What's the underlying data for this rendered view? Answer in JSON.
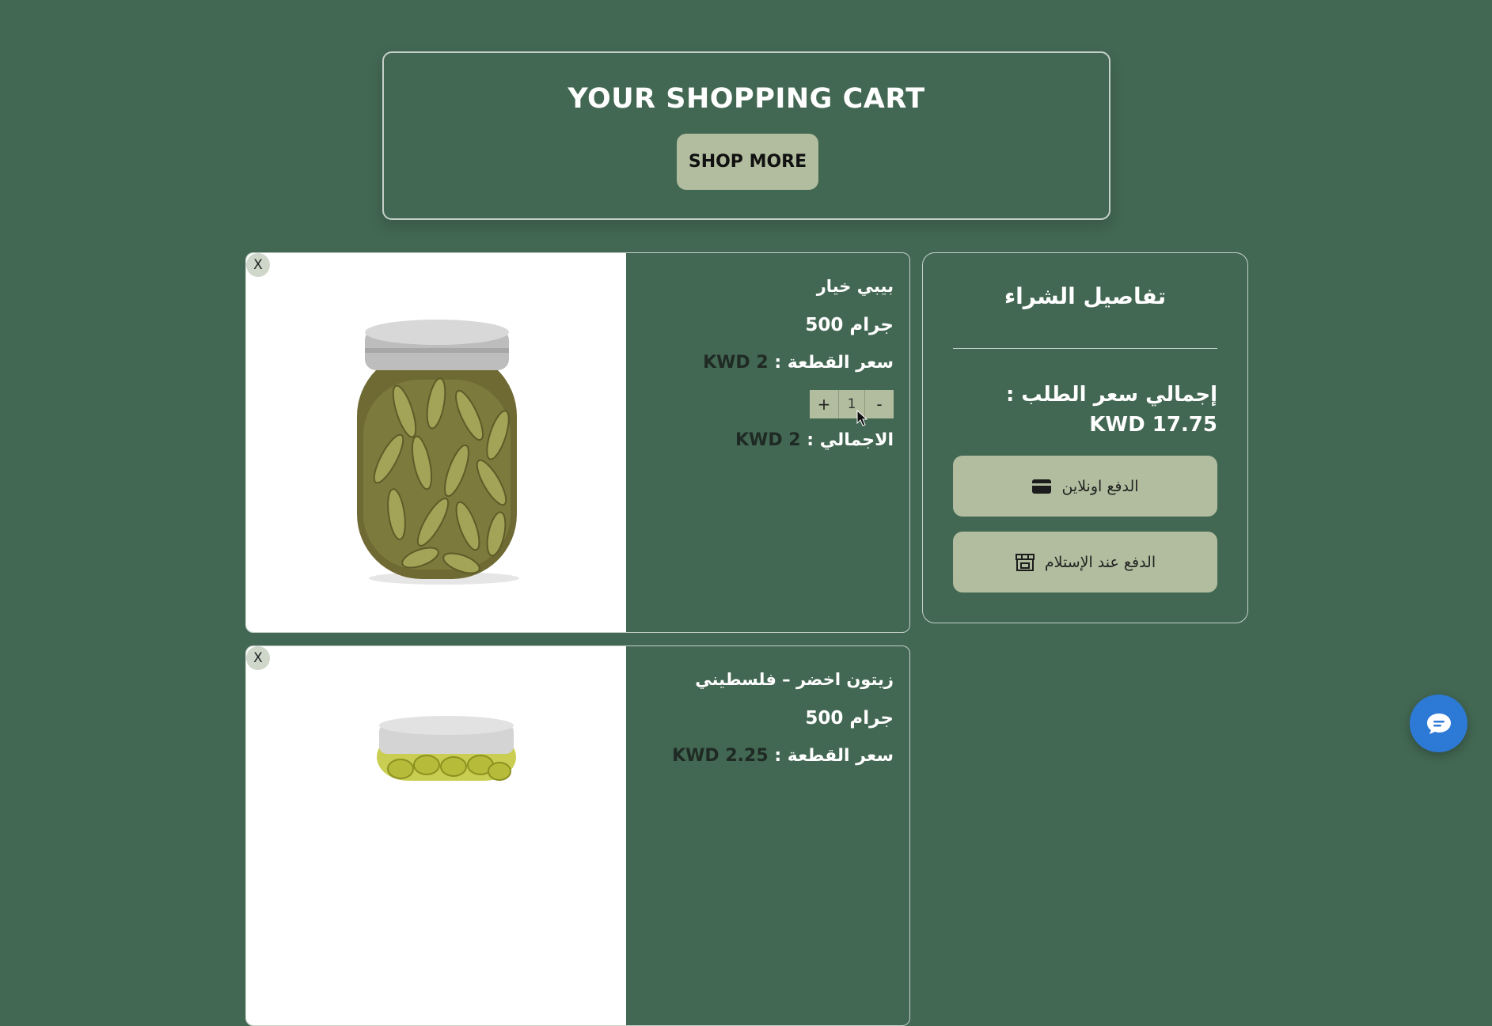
{
  "header": {
    "title": "YOUR SHOPPING CART",
    "shop_more_label": "SHOP MORE"
  },
  "cart_items": [
    {
      "remove_label": "X",
      "name": "بيبي خيار",
      "weight": "جرام 500",
      "unit_price_label": "سعر القطعة :",
      "unit_price_value": "2 KWD",
      "quantity": "1",
      "qty_plus": "+",
      "qty_minus": "-",
      "total_label": "الاجمالي :",
      "total_value": "2 KWD"
    },
    {
      "remove_label": "X",
      "name": "زيتون اخضر – فلسطيني",
      "weight": "جرام 500",
      "unit_price_label": "سعر القطعة :",
      "unit_price_value": "2.25 KWD"
    }
  ],
  "summary": {
    "title": "تفاصيل الشراء",
    "total_text": "إجمالي سعر الطلب : 17.75 KWD",
    "pay_online_label": "الدفع اونلاين",
    "pay_cod_label": "الدفع عند الإستلام"
  },
  "colors": {
    "background": "#426752",
    "button": "#b1bd9e",
    "chat": "#2d79d6"
  },
  "icons": {
    "pay_online": "credit-card-icon",
    "pay_cod": "store-icon",
    "chat": "chat-icon"
  }
}
